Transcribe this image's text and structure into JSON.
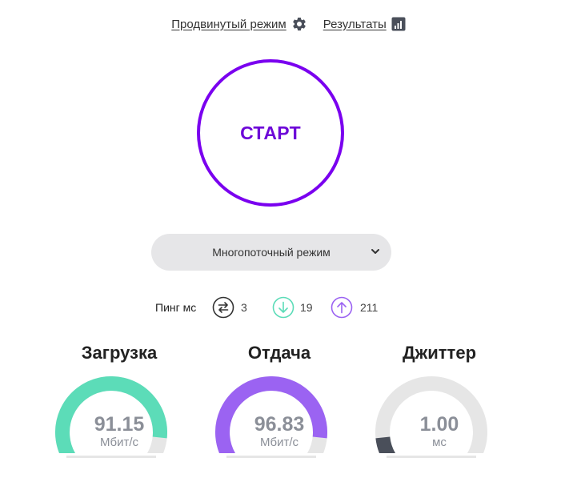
{
  "nav": {
    "advanced_label": "Продвинутый режим",
    "results_label": "Результаты"
  },
  "start_label": "СТАРТ",
  "mode_select": {
    "selected": "Многопоточный режим"
  },
  "ping": {
    "label": "Пинг мс",
    "idle": "3",
    "download": "19",
    "upload": "211"
  },
  "metrics": [
    {
      "title": "Загрузка",
      "value": "91.15",
      "unit": "Мбит/с",
      "fill": 0.9,
      "color": "#5cdcb8"
    },
    {
      "title": "Отдача",
      "value": "96.83",
      "unit": "Мбит/с",
      "fill": 0.9,
      "color": "#9b63f2"
    },
    {
      "title": "Джиттер",
      "value": "1.00",
      "unit": "мс",
      "fill": 0.1,
      "color": "#4a4f5a"
    }
  ],
  "colors": {
    "accent": "#7a00ef",
    "track": "#e6e6e6",
    "ping_download": "#5cdcb8",
    "ping_upload": "#9b63f2",
    "ping_idle": "#333333"
  }
}
